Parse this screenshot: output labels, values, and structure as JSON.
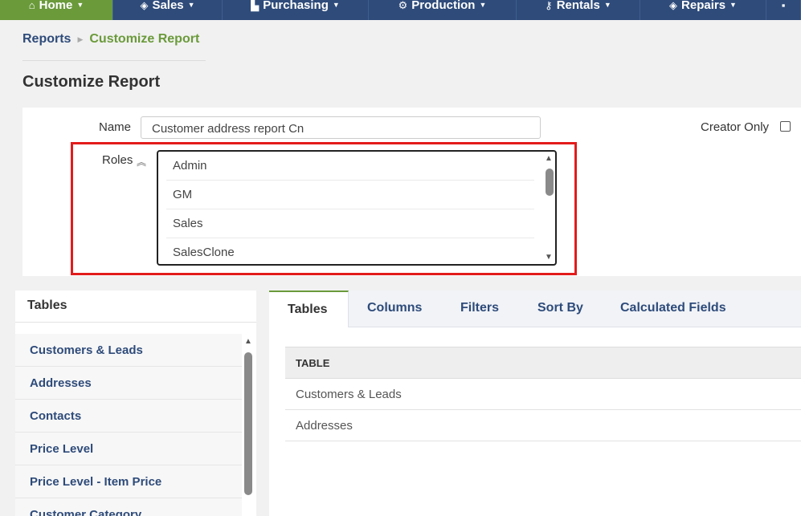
{
  "nav": {
    "items": [
      {
        "icon": "home-icon",
        "glyph": "⌂",
        "label": "Home"
      },
      {
        "icon": "tag-icon",
        "glyph": "◈",
        "label": "Sales"
      },
      {
        "icon": "cart-icon",
        "glyph": "🛒",
        "label": "Purchasing"
      },
      {
        "icon": "gears-icon",
        "glyph": "⚙",
        "label": "Production"
      },
      {
        "icon": "key-icon",
        "glyph": "⚷",
        "label": "Rentals"
      },
      {
        "icon": "wrench-icon",
        "glyph": "◈",
        "label": "Repairs"
      }
    ],
    "active_color": "#6a9a3a",
    "bar_color": "#2e4b7a"
  },
  "breadcrumb": {
    "parent": "Reports",
    "current": "Customize Report"
  },
  "page_title": "Customize Report",
  "form": {
    "name_label": "Name",
    "name_value": "Customer address report Cn",
    "creator_only_label": "Creator Only",
    "creator_only_checked": false,
    "roles_label": "Roles",
    "roles": [
      "Admin",
      "GM",
      "Sales",
      "SalesClone"
    ]
  },
  "tables_panel": {
    "title": "Tables",
    "items": [
      "Customers & Leads",
      "Addresses",
      "Contacts",
      "Price Level",
      "Price Level - Item Price",
      "Customer Category"
    ]
  },
  "tabs": [
    "Tables",
    "Columns",
    "Filters",
    "Sort By",
    "Calculated Fields"
  ],
  "active_tab": "Tables",
  "selected_table": {
    "header": "TABLE",
    "rows": [
      "Customers & Leads",
      "Addresses"
    ]
  }
}
